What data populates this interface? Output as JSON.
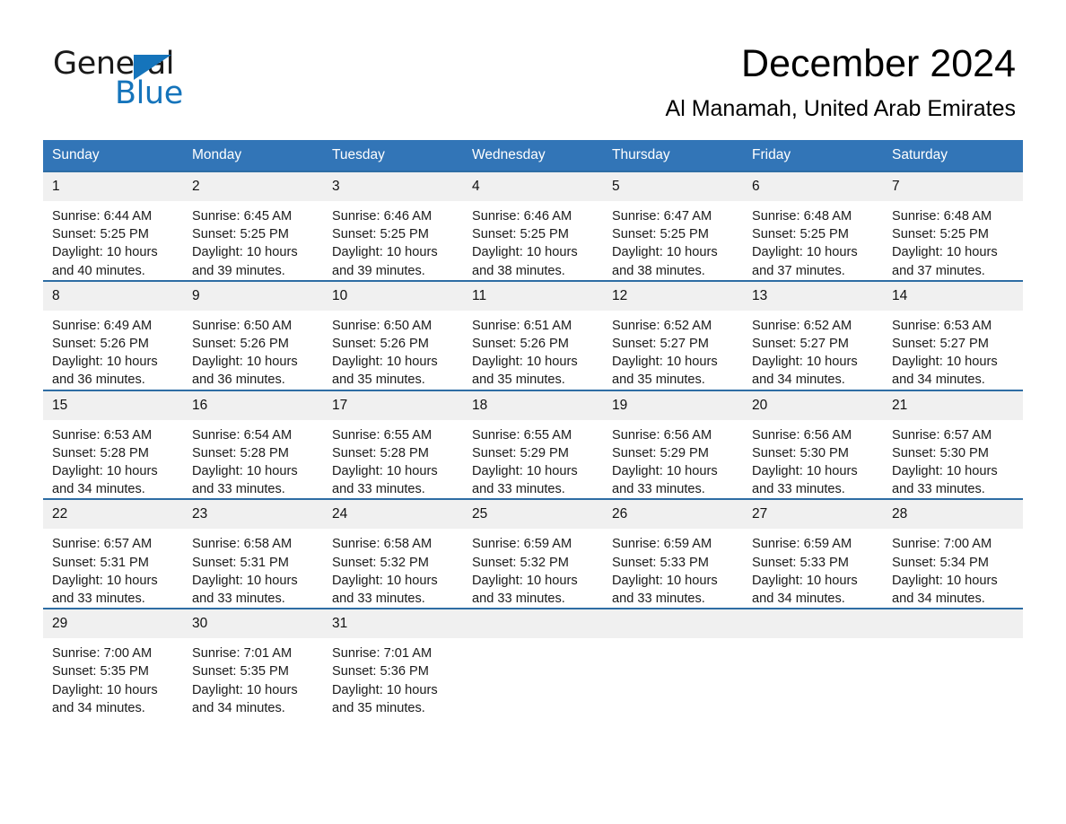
{
  "brand": {
    "name_part1": "General",
    "name_part2": "Blue"
  },
  "header": {
    "title": "December 2024",
    "location": "Al Manamah, United Arab Emirates"
  },
  "colors": {
    "header_blue": "#3275b7",
    "row_border_blue": "#2e6da4",
    "datenum_bg": "#f0f0f0",
    "brand_blue": "#1574bb"
  },
  "weekdays": [
    "Sunday",
    "Monday",
    "Tuesday",
    "Wednesday",
    "Thursday",
    "Friday",
    "Saturday"
  ],
  "labels": {
    "sunrise": "Sunrise:",
    "sunset": "Sunset:",
    "daylight": "Daylight:"
  },
  "weeks": [
    [
      {
        "day": "1",
        "sunrise": "Sunrise: 6:44 AM",
        "sunset": "Sunset: 5:25 PM",
        "daylight_1": "Daylight: 10 hours",
        "daylight_2": "and 40 minutes."
      },
      {
        "day": "2",
        "sunrise": "Sunrise: 6:45 AM",
        "sunset": "Sunset: 5:25 PM",
        "daylight_1": "Daylight: 10 hours",
        "daylight_2": "and 39 minutes."
      },
      {
        "day": "3",
        "sunrise": "Sunrise: 6:46 AM",
        "sunset": "Sunset: 5:25 PM",
        "daylight_1": "Daylight: 10 hours",
        "daylight_2": "and 39 minutes."
      },
      {
        "day": "4",
        "sunrise": "Sunrise: 6:46 AM",
        "sunset": "Sunset: 5:25 PM",
        "daylight_1": "Daylight: 10 hours",
        "daylight_2": "and 38 minutes."
      },
      {
        "day": "5",
        "sunrise": "Sunrise: 6:47 AM",
        "sunset": "Sunset: 5:25 PM",
        "daylight_1": "Daylight: 10 hours",
        "daylight_2": "and 38 minutes."
      },
      {
        "day": "6",
        "sunrise": "Sunrise: 6:48 AM",
        "sunset": "Sunset: 5:25 PM",
        "daylight_1": "Daylight: 10 hours",
        "daylight_2": "and 37 minutes."
      },
      {
        "day": "7",
        "sunrise": "Sunrise: 6:48 AM",
        "sunset": "Sunset: 5:25 PM",
        "daylight_1": "Daylight: 10 hours",
        "daylight_2": "and 37 minutes."
      }
    ],
    [
      {
        "day": "8",
        "sunrise": "Sunrise: 6:49 AM",
        "sunset": "Sunset: 5:26 PM",
        "daylight_1": "Daylight: 10 hours",
        "daylight_2": "and 36 minutes."
      },
      {
        "day": "9",
        "sunrise": "Sunrise: 6:50 AM",
        "sunset": "Sunset: 5:26 PM",
        "daylight_1": "Daylight: 10 hours",
        "daylight_2": "and 36 minutes."
      },
      {
        "day": "10",
        "sunrise": "Sunrise: 6:50 AM",
        "sunset": "Sunset: 5:26 PM",
        "daylight_1": "Daylight: 10 hours",
        "daylight_2": "and 35 minutes."
      },
      {
        "day": "11",
        "sunrise": "Sunrise: 6:51 AM",
        "sunset": "Sunset: 5:26 PM",
        "daylight_1": "Daylight: 10 hours",
        "daylight_2": "and 35 minutes."
      },
      {
        "day": "12",
        "sunrise": "Sunrise: 6:52 AM",
        "sunset": "Sunset: 5:27 PM",
        "daylight_1": "Daylight: 10 hours",
        "daylight_2": "and 35 minutes."
      },
      {
        "day": "13",
        "sunrise": "Sunrise: 6:52 AM",
        "sunset": "Sunset: 5:27 PM",
        "daylight_1": "Daylight: 10 hours",
        "daylight_2": "and 34 minutes."
      },
      {
        "day": "14",
        "sunrise": "Sunrise: 6:53 AM",
        "sunset": "Sunset: 5:27 PM",
        "daylight_1": "Daylight: 10 hours",
        "daylight_2": "and 34 minutes."
      }
    ],
    [
      {
        "day": "15",
        "sunrise": "Sunrise: 6:53 AM",
        "sunset": "Sunset: 5:28 PM",
        "daylight_1": "Daylight: 10 hours",
        "daylight_2": "and 34 minutes."
      },
      {
        "day": "16",
        "sunrise": "Sunrise: 6:54 AM",
        "sunset": "Sunset: 5:28 PM",
        "daylight_1": "Daylight: 10 hours",
        "daylight_2": "and 33 minutes."
      },
      {
        "day": "17",
        "sunrise": "Sunrise: 6:55 AM",
        "sunset": "Sunset: 5:28 PM",
        "daylight_1": "Daylight: 10 hours",
        "daylight_2": "and 33 minutes."
      },
      {
        "day": "18",
        "sunrise": "Sunrise: 6:55 AM",
        "sunset": "Sunset: 5:29 PM",
        "daylight_1": "Daylight: 10 hours",
        "daylight_2": "and 33 minutes."
      },
      {
        "day": "19",
        "sunrise": "Sunrise: 6:56 AM",
        "sunset": "Sunset: 5:29 PM",
        "daylight_1": "Daylight: 10 hours",
        "daylight_2": "and 33 minutes."
      },
      {
        "day": "20",
        "sunrise": "Sunrise: 6:56 AM",
        "sunset": "Sunset: 5:30 PM",
        "daylight_1": "Daylight: 10 hours",
        "daylight_2": "and 33 minutes."
      },
      {
        "day": "21",
        "sunrise": "Sunrise: 6:57 AM",
        "sunset": "Sunset: 5:30 PM",
        "daylight_1": "Daylight: 10 hours",
        "daylight_2": "and 33 minutes."
      }
    ],
    [
      {
        "day": "22",
        "sunrise": "Sunrise: 6:57 AM",
        "sunset": "Sunset: 5:31 PM",
        "daylight_1": "Daylight: 10 hours",
        "daylight_2": "and 33 minutes."
      },
      {
        "day": "23",
        "sunrise": "Sunrise: 6:58 AM",
        "sunset": "Sunset: 5:31 PM",
        "daylight_1": "Daylight: 10 hours",
        "daylight_2": "and 33 minutes."
      },
      {
        "day": "24",
        "sunrise": "Sunrise: 6:58 AM",
        "sunset": "Sunset: 5:32 PM",
        "daylight_1": "Daylight: 10 hours",
        "daylight_2": "and 33 minutes."
      },
      {
        "day": "25",
        "sunrise": "Sunrise: 6:59 AM",
        "sunset": "Sunset: 5:32 PM",
        "daylight_1": "Daylight: 10 hours",
        "daylight_2": "and 33 minutes."
      },
      {
        "day": "26",
        "sunrise": "Sunrise: 6:59 AM",
        "sunset": "Sunset: 5:33 PM",
        "daylight_1": "Daylight: 10 hours",
        "daylight_2": "and 33 minutes."
      },
      {
        "day": "27",
        "sunrise": "Sunrise: 6:59 AM",
        "sunset": "Sunset: 5:33 PM",
        "daylight_1": "Daylight: 10 hours",
        "daylight_2": "and 34 minutes."
      },
      {
        "day": "28",
        "sunrise": "Sunrise: 7:00 AM",
        "sunset": "Sunset: 5:34 PM",
        "daylight_1": "Daylight: 10 hours",
        "daylight_2": "and 34 minutes."
      }
    ],
    [
      {
        "day": "29",
        "sunrise": "Sunrise: 7:00 AM",
        "sunset": "Sunset: 5:35 PM",
        "daylight_1": "Daylight: 10 hours",
        "daylight_2": "and 34 minutes."
      },
      {
        "day": "30",
        "sunrise": "Sunrise: 7:01 AM",
        "sunset": "Sunset: 5:35 PM",
        "daylight_1": "Daylight: 10 hours",
        "daylight_2": "and 34 minutes."
      },
      {
        "day": "31",
        "sunrise": "Sunrise: 7:01 AM",
        "sunset": "Sunset: 5:36 PM",
        "daylight_1": "Daylight: 10 hours",
        "daylight_2": "and 35 minutes."
      },
      {
        "day": "",
        "sunrise": "",
        "sunset": "",
        "daylight_1": "",
        "daylight_2": ""
      },
      {
        "day": "",
        "sunrise": "",
        "sunset": "",
        "daylight_1": "",
        "daylight_2": ""
      },
      {
        "day": "",
        "sunrise": "",
        "sunset": "",
        "daylight_1": "",
        "daylight_2": ""
      },
      {
        "day": "",
        "sunrise": "",
        "sunset": "",
        "daylight_1": "",
        "daylight_2": ""
      }
    ]
  ]
}
